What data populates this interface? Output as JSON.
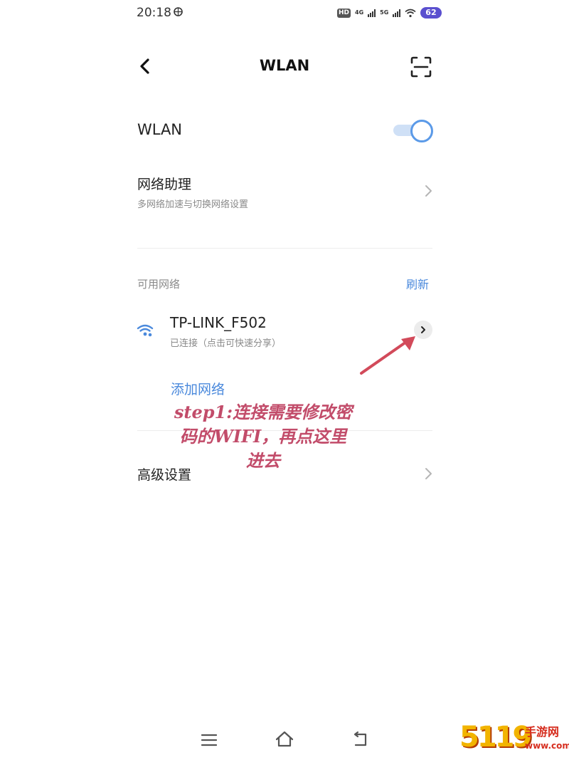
{
  "status_bar": {
    "time": "20:18",
    "hd_label": "HD",
    "net1": "4G",
    "net2": "5G",
    "battery": "62"
  },
  "header": {
    "title": "WLAN"
  },
  "wlan_toggle": {
    "label": "WLAN",
    "enabled": true
  },
  "network_assistant": {
    "title": "网络助理",
    "subtitle": "多网络加速与切换网络设置"
  },
  "available": {
    "section_label": "可用网络",
    "refresh_label": "刷新",
    "networks": [
      {
        "name": "TP-LINK_F502",
        "status": "已连接（点击可快速分享）"
      }
    ]
  },
  "add_network_label": "添加网络",
  "advanced_settings_label": "高级设置",
  "annotation": {
    "line1": "step1:连接需要修改密",
    "line2": "码的WIFI，再点这里",
    "line3": "进去"
  },
  "watermark": {
    "number": "5119",
    "text": "手游网",
    "url": "www.com.cn"
  },
  "colors": {
    "accent": "#4a89dc",
    "annotation": "#c24c6a",
    "battery": "#5a4fcf"
  }
}
